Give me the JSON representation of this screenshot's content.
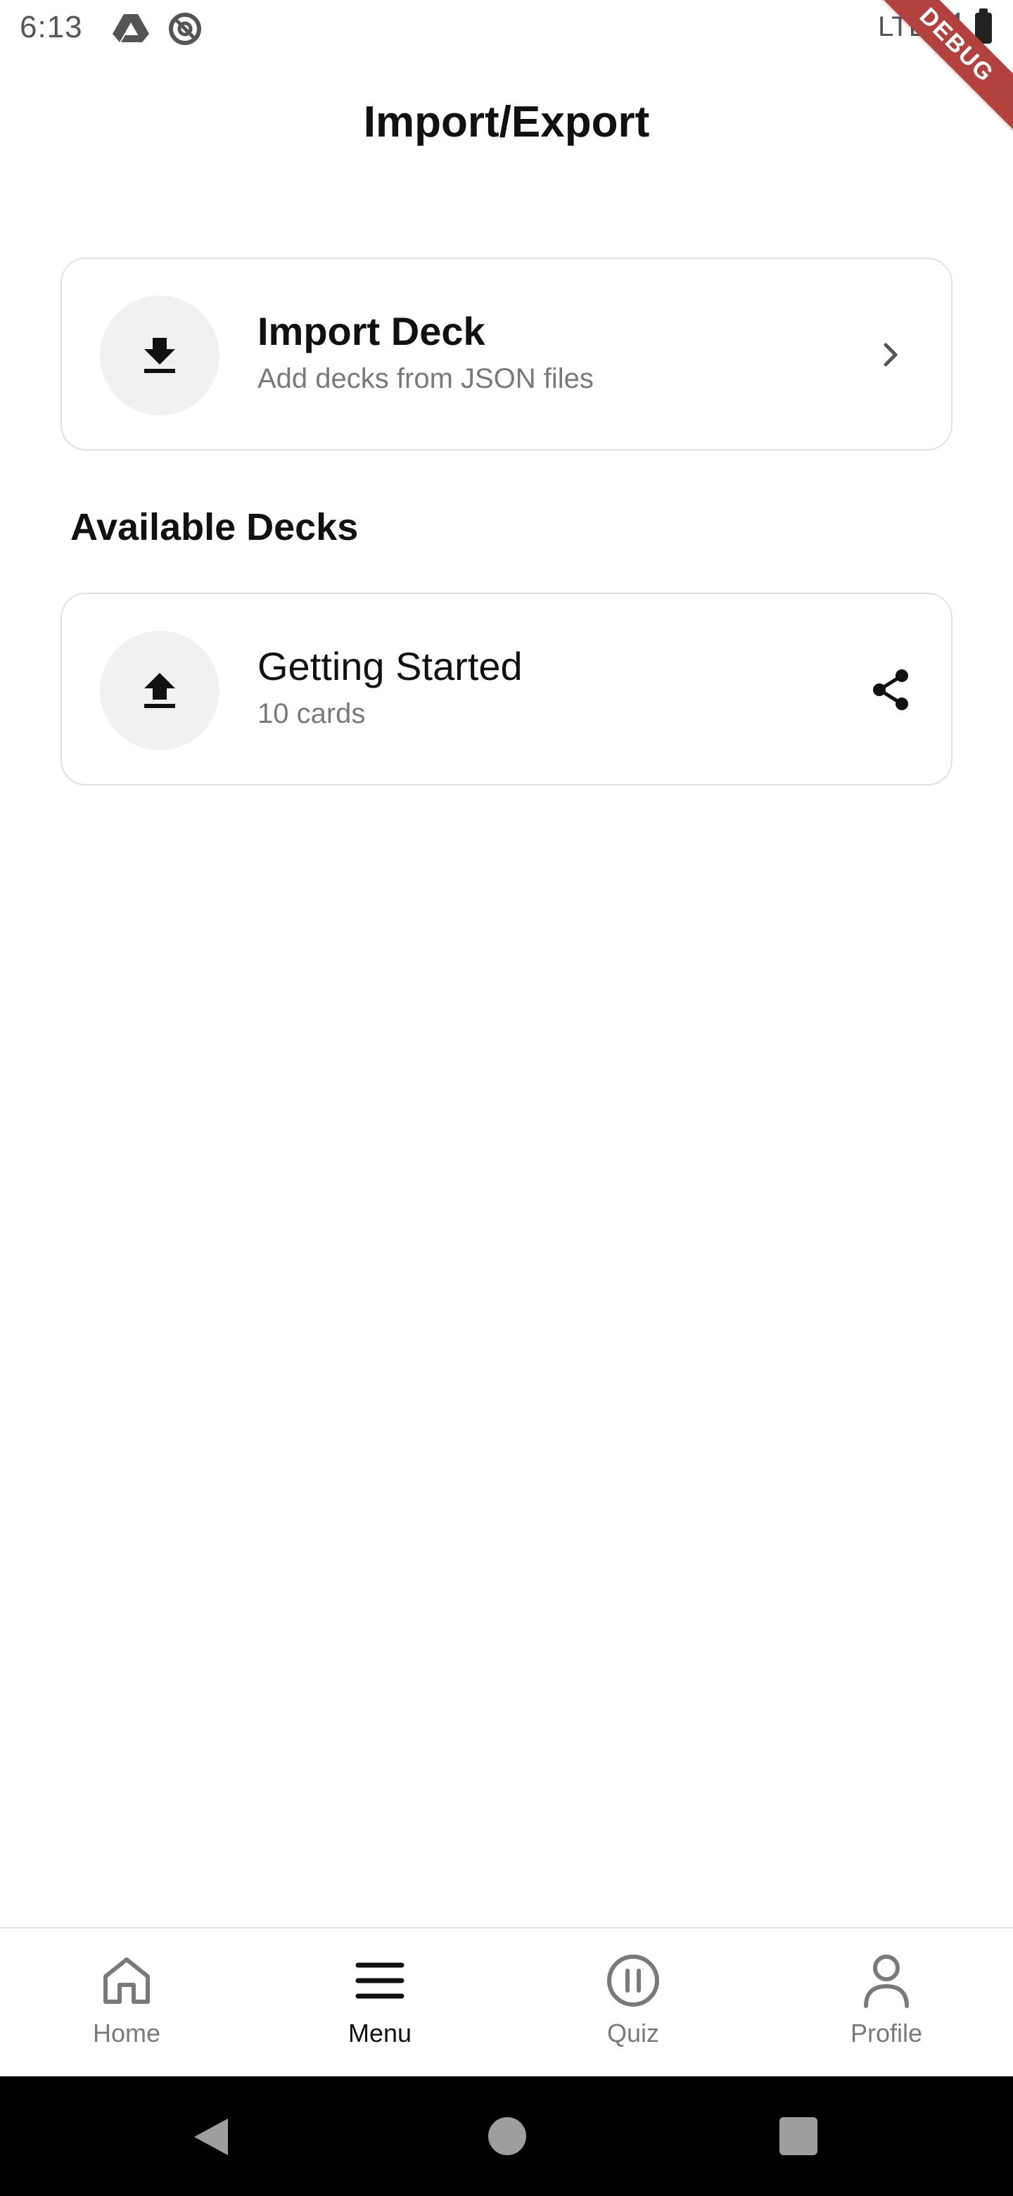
{
  "status_bar": {
    "time": "6:13",
    "network": "LTE",
    "icons": [
      "drive-icon",
      "at-sign-icon",
      "signal-icon",
      "battery-icon"
    ]
  },
  "debug_banner": "DEBUG",
  "header": {
    "title": "Import/Export"
  },
  "import_card": {
    "title": "Import Deck",
    "subtitle": "Add decks from JSON files",
    "icon": "download-icon",
    "trailing_icon": "chevron-right-icon"
  },
  "available_decks": {
    "heading": "Available Decks",
    "items": [
      {
        "title": "Getting Started",
        "subtitle": "10 cards",
        "icon": "upload-icon",
        "action_icon": "share-icon"
      }
    ]
  },
  "bottom_nav": {
    "items": [
      {
        "label": "Home",
        "icon": "home-icon",
        "active": false
      },
      {
        "label": "Menu",
        "icon": "menu-icon",
        "active": true
      },
      {
        "label": "Quiz",
        "icon": "pause-circle-icon",
        "active": false
      },
      {
        "label": "Profile",
        "icon": "person-icon",
        "active": false
      }
    ]
  },
  "colors": {
    "debug_ribbon": "#b3413d",
    "text_primary": "#111111",
    "text_secondary": "#7a7a7a",
    "icon_circle_bg": "#f1f1f1",
    "card_border": "#e2e2e2"
  }
}
